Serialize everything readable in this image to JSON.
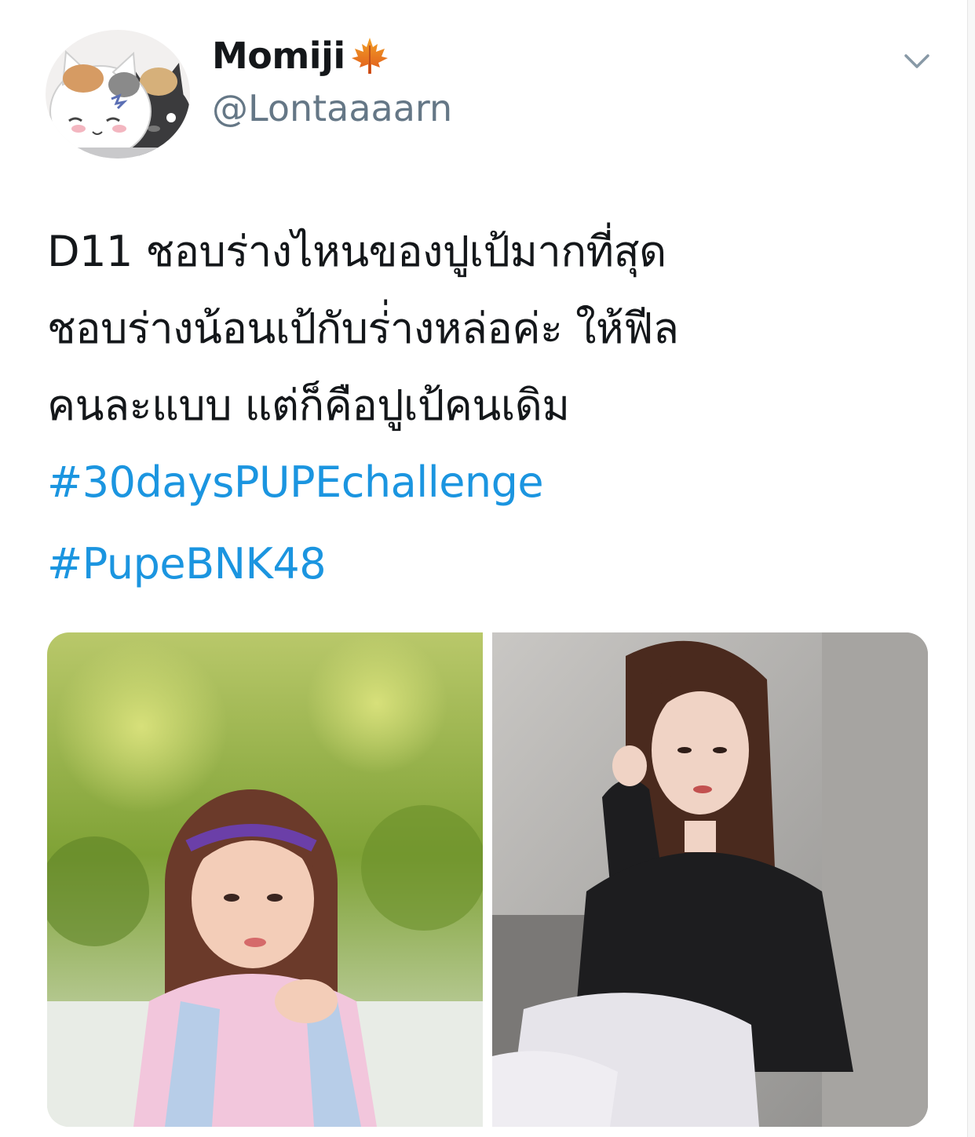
{
  "user": {
    "display_name": "Momiji",
    "handle": "@Lontaaaarn",
    "avatar_icon": "cat-avatar-icon",
    "badge_icon": "maple-leaf-icon"
  },
  "menu": {
    "icon": "chevron-down-icon"
  },
  "tweet": {
    "lines": [
      "D11 ชอบร่างไหนของปูเป้มากที่สุด",
      "ชอบร่างน้อนเป้กับร่่างหล่อค่ะ ให้ฟีล",
      "คนละแบบ แต่ก็คือปูเป้คนเดิม"
    ],
    "hashtags": [
      "#30daysPUPEchallenge",
      "#PupeBNK48"
    ]
  },
  "media": {
    "photos": [
      {
        "name": "photo-pink-outfit"
      },
      {
        "name": "photo-black-shirt"
      }
    ]
  },
  "colors": {
    "text": "#14171a",
    "secondary": "#657786",
    "link": "#1b95e0"
  }
}
